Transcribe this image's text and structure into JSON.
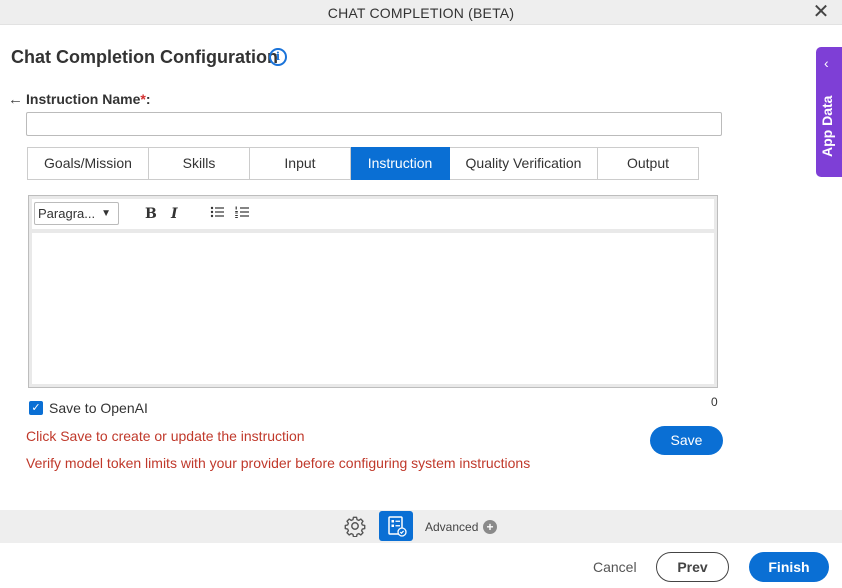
{
  "window": {
    "title": "CHAT COMPLETION (BETA)",
    "close_glyph": "✕"
  },
  "heading": "Chat Completion Configuration",
  "field": {
    "label": "Instruction Name",
    "required_mark": "*",
    "suffix": ":",
    "value": ""
  },
  "tabs": [
    {
      "label": "Goals/Mission",
      "active": false
    },
    {
      "label": "Skills",
      "active": false
    },
    {
      "label": "Input",
      "active": false
    },
    {
      "label": "Instruction",
      "active": true
    },
    {
      "label": "Quality Verification",
      "active": false
    },
    {
      "label": "Output",
      "active": false
    }
  ],
  "editor": {
    "paragraph_select": "Paragra...",
    "bold": "B",
    "italic": "I",
    "content": "",
    "char_count": "0"
  },
  "save_to_openai": {
    "label": "Save to OpenAI",
    "checked": true
  },
  "messages": {
    "save_hint": "Click Save to create or update the instruction",
    "token_warning": "Verify model token limits with your provider before configuring system instructions"
  },
  "save_button": "Save",
  "side_panel": {
    "label": "App Data"
  },
  "bottom_toolbar": {
    "advanced_label": "Advanced"
  },
  "footer": {
    "cancel": "Cancel",
    "prev": "Prev",
    "finish": "Finish"
  },
  "colors": {
    "accent": "#0a6fd4",
    "side_panel": "#7e3fd6",
    "error_text": "#c0392b",
    "required": "#d32f2f"
  },
  "icons": [
    "close-icon",
    "info-icon",
    "back-arrow-icon",
    "bullet-list-icon",
    "numbered-list-icon",
    "chevron-left-icon",
    "gear-icon",
    "form-settings-icon",
    "plus-circle-icon",
    "check-icon"
  ]
}
